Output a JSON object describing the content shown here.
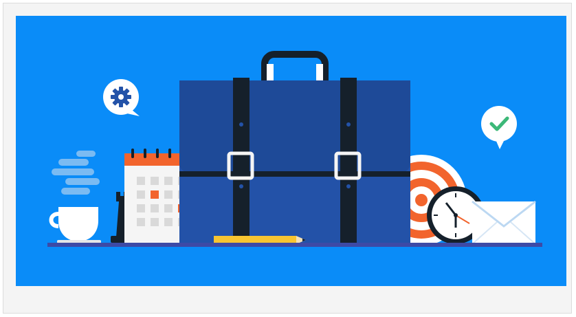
{
  "image": {
    "description_name": "work-tools-illustration"
  },
  "colors": {
    "frame_bg": "#f4f4f4",
    "frame_border": "#dcdcdc",
    "sky": "#0a8cf8",
    "briefcase": "#2352a8",
    "briefcase_shade": "#1e4a98",
    "strap": "#15202b",
    "shelf": "#3d4aa6",
    "accent_orange": "#f2642d",
    "bubble": "#ffffff",
    "check": "#3cb878",
    "gear": "#2352a8",
    "pencil": "#f7c531",
    "steam": "#8fc4f2"
  }
}
